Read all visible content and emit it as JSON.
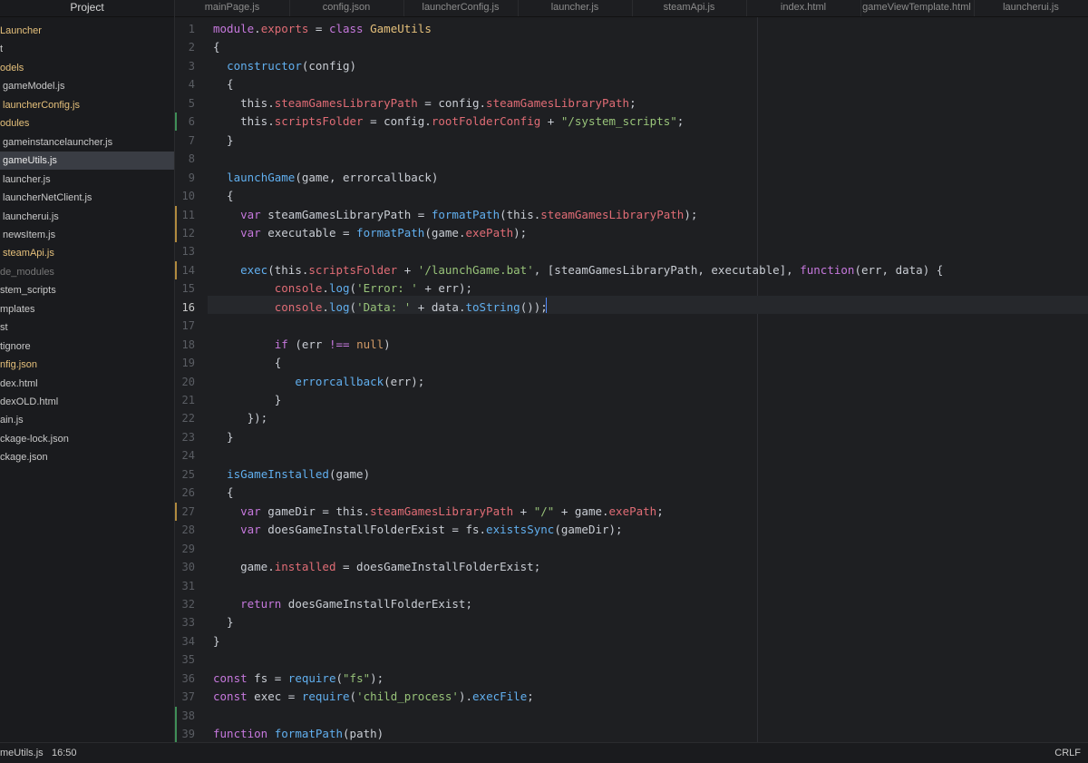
{
  "sidebar": {
    "title": "Project",
    "items": [
      {
        "label": "Launcher",
        "kind": "folder"
      },
      {
        "label": "t",
        "kind": "file"
      },
      {
        "label": "odels",
        "kind": "folder"
      },
      {
        "label": "gameModel.js",
        "kind": "file"
      },
      {
        "label": "launcherConfig.js",
        "kind": "modified"
      },
      {
        "label": "odules",
        "kind": "folder"
      },
      {
        "label": "gameinstancelauncher.js",
        "kind": "file"
      },
      {
        "label": "gameUtils.js",
        "kind": "selected"
      },
      {
        "label": "launcher.js",
        "kind": "file"
      },
      {
        "label": "launcherNetClient.js",
        "kind": "file"
      },
      {
        "label": "launcherui.js",
        "kind": "file"
      },
      {
        "label": "newsItem.js",
        "kind": "file"
      },
      {
        "label": "steamApi.js",
        "kind": "modified"
      },
      {
        "label": "de_modules",
        "kind": "dim"
      },
      {
        "label": "stem_scripts",
        "kind": "file"
      },
      {
        "label": "mplates",
        "kind": "file"
      },
      {
        "label": "st",
        "kind": "file"
      },
      {
        "label": "tignore",
        "kind": "file"
      },
      {
        "label": "nfig.json",
        "kind": "modified"
      },
      {
        "label": "dex.html",
        "kind": "file"
      },
      {
        "label": "dexOLD.html",
        "kind": "file"
      },
      {
        "label": "ain.js",
        "kind": "file"
      },
      {
        "label": "ckage-lock.json",
        "kind": "file"
      },
      {
        "label": "ckage.json",
        "kind": "file"
      }
    ],
    "collapse_glyph": "‹"
  },
  "tabs": [
    {
      "label": "mainPage.js"
    },
    {
      "label": "config.json"
    },
    {
      "label": "launcherConfig.js"
    },
    {
      "label": "launcher.js"
    },
    {
      "label": "steamApi.js"
    },
    {
      "label": "index.html"
    },
    {
      "label": "gameViewTemplate.html"
    },
    {
      "label": "launcherui.js"
    }
  ],
  "editor": {
    "current_line": 16,
    "lines": [
      [
        [
          "kw",
          "module"
        ],
        [
          "op",
          "."
        ],
        [
          "prop",
          "exports"
        ],
        [
          "op",
          " = "
        ],
        [
          "kw",
          "class"
        ],
        [
          "op",
          " "
        ],
        [
          "cls",
          "GameUtils"
        ]
      ],
      [
        [
          "op",
          "{"
        ]
      ],
      [
        [
          "op",
          "  "
        ],
        [
          "fn",
          "constructor"
        ],
        [
          "op",
          "(config)"
        ]
      ],
      [
        [
          "op",
          "  {"
        ]
      ],
      [
        [
          "op",
          "    this."
        ],
        [
          "prop",
          "steamGamesLibraryPath"
        ],
        [
          "op",
          " = config."
        ],
        [
          "prop",
          "steamGamesLibraryPath"
        ],
        [
          "op",
          ";"
        ]
      ],
      [
        [
          "op",
          "    this."
        ],
        [
          "prop",
          "scriptsFolder"
        ],
        [
          "op",
          " = config."
        ],
        [
          "prop",
          "rootFolderConfig"
        ],
        [
          "op",
          " + "
        ],
        [
          "str",
          "\"/system_scripts\""
        ],
        [
          "op",
          ";"
        ]
      ],
      [
        [
          "op",
          "  }"
        ]
      ],
      [],
      [
        [
          "op",
          "  "
        ],
        [
          "fn",
          "launchGame"
        ],
        [
          "op",
          "(game, errorcallback)"
        ]
      ],
      [
        [
          "op",
          "  {"
        ]
      ],
      [
        [
          "op",
          "    "
        ],
        [
          "kw",
          "var"
        ],
        [
          "op",
          " steamGamesLibraryPath = "
        ],
        [
          "fn",
          "formatPath"
        ],
        [
          "op",
          "(this."
        ],
        [
          "prop",
          "steamGamesLibraryPath"
        ],
        [
          "op",
          ");"
        ]
      ],
      [
        [
          "op",
          "    "
        ],
        [
          "kw",
          "var"
        ],
        [
          "op",
          " executable = "
        ],
        [
          "fn",
          "formatPath"
        ],
        [
          "op",
          "(game."
        ],
        [
          "prop",
          "exePath"
        ],
        [
          "op",
          ");"
        ]
      ],
      [],
      [
        [
          "op",
          "    "
        ],
        [
          "fn",
          "exec"
        ],
        [
          "op",
          "(this."
        ],
        [
          "prop",
          "scriptsFolder"
        ],
        [
          "op",
          " + "
        ],
        [
          "str",
          "'/launchGame.bat'"
        ],
        [
          "op",
          ", [steamGamesLibraryPath, executable], "
        ],
        [
          "kw",
          "function"
        ],
        [
          "op",
          "(err, data) {"
        ]
      ],
      [
        [
          "op",
          "         "
        ],
        [
          "prop",
          "console"
        ],
        [
          "op",
          "."
        ],
        [
          "fn",
          "log"
        ],
        [
          "op",
          "("
        ],
        [
          "str",
          "'Error: '"
        ],
        [
          "op",
          " + err);"
        ]
      ],
      [
        [
          "op",
          "         "
        ],
        [
          "prop",
          "console"
        ],
        [
          "op",
          "."
        ],
        [
          "fn",
          "log"
        ],
        [
          "op",
          "("
        ],
        [
          "str",
          "'Data: '"
        ],
        [
          "op",
          " + data."
        ],
        [
          "fn",
          "toString"
        ],
        [
          "op",
          "());"
        ]
      ],
      [],
      [
        [
          "op",
          "         "
        ],
        [
          "kw",
          "if"
        ],
        [
          "op",
          " (err "
        ],
        [
          "kw",
          "!=="
        ],
        [
          "op",
          " "
        ],
        [
          "num",
          "null"
        ],
        [
          "op",
          ")"
        ]
      ],
      [
        [
          "op",
          "         {"
        ]
      ],
      [
        [
          "op",
          "            "
        ],
        [
          "fn",
          "errorcallback"
        ],
        [
          "op",
          "(err);"
        ]
      ],
      [
        [
          "op",
          "         }"
        ]
      ],
      [
        [
          "op",
          "     });"
        ]
      ],
      [
        [
          "op",
          "  }"
        ]
      ],
      [],
      [
        [
          "op",
          "  "
        ],
        [
          "fn",
          "isGameInstalled"
        ],
        [
          "op",
          "(game)"
        ]
      ],
      [
        [
          "op",
          "  {"
        ]
      ],
      [
        [
          "op",
          "    "
        ],
        [
          "kw",
          "var"
        ],
        [
          "op",
          " gameDir = this."
        ],
        [
          "prop",
          "steamGamesLibraryPath"
        ],
        [
          "op",
          " + "
        ],
        [
          "str",
          "\"/\""
        ],
        [
          "op",
          " + game."
        ],
        [
          "prop",
          "exePath"
        ],
        [
          "op",
          ";"
        ]
      ],
      [
        [
          "op",
          "    "
        ],
        [
          "kw",
          "var"
        ],
        [
          "op",
          " doesGameInstallFolderExist = fs."
        ],
        [
          "fn",
          "existsSync"
        ],
        [
          "op",
          "(gameDir);"
        ]
      ],
      [],
      [
        [
          "op",
          "    game."
        ],
        [
          "prop",
          "installed"
        ],
        [
          "op",
          " = doesGameInstallFolderExist;"
        ]
      ],
      [],
      [
        [
          "op",
          "    "
        ],
        [
          "kw",
          "return"
        ],
        [
          "op",
          " doesGameInstallFolderExist;"
        ]
      ],
      [
        [
          "op",
          "  }"
        ]
      ],
      [
        [
          "op",
          "}"
        ]
      ],
      [],
      [
        [
          "kw",
          "const"
        ],
        [
          "op",
          " fs = "
        ],
        [
          "fn",
          "require"
        ],
        [
          "op",
          "("
        ],
        [
          "str",
          "\"fs\""
        ],
        [
          "op",
          ");"
        ]
      ],
      [
        [
          "kw",
          "const"
        ],
        [
          "op",
          " exec = "
        ],
        [
          "fn",
          "require"
        ],
        [
          "op",
          "("
        ],
        [
          "str",
          "'child_process'"
        ],
        [
          "op",
          ")."
        ],
        [
          "fn",
          "execFile"
        ],
        [
          "op",
          ";"
        ]
      ],
      [],
      [
        [
          "kw",
          "function"
        ],
        [
          "op",
          " "
        ],
        [
          "fn",
          "formatPath"
        ],
        [
          "op",
          "(path)"
        ]
      ]
    ],
    "git_marks": [
      {
        "line": 6,
        "color": "#3f8f57"
      },
      {
        "line": 11,
        "color": "#b08a3e"
      },
      {
        "line": 12,
        "color": "#b08a3e"
      },
      {
        "line": 14,
        "color": "#b08a3e"
      },
      {
        "line": 27,
        "color": "#b08a3e"
      },
      {
        "line": 38,
        "color": "#3f8f57"
      },
      {
        "line": 39,
        "color": "#3f8f57"
      }
    ]
  },
  "statusbar": {
    "file": "meUtils.js",
    "cursor": "16:50",
    "eol": "CRLF"
  }
}
